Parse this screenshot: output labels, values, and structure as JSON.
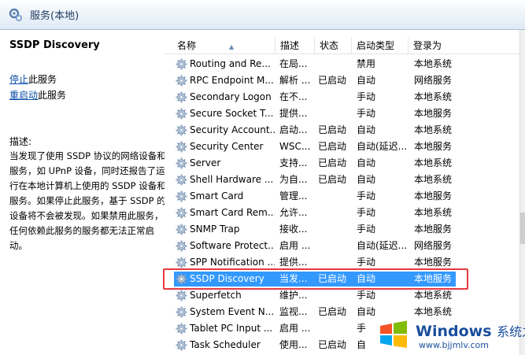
{
  "header": {
    "title": "服务(本地)"
  },
  "left_panel": {
    "service_name": "SSDP Discovery",
    "stop_link": "停止",
    "stop_suffix": "此服务",
    "restart_link": "重启动",
    "restart_suffix": "此服务",
    "description_label": "描述:",
    "description": "当发现了使用 SSDP 协议的网络设备和服务，如 UPnP 设备，同时还报告了运行在本地计算机上使用的 SSDP 设备和服务。如果停止此服务，基于 SSDP 的设备将不会被发现。如果禁用此服务，任何依赖此服务的服务都无法正常启动。"
  },
  "columns": {
    "name": "名称",
    "description": "描述",
    "status": "状态",
    "startup": "启动类型",
    "logon": "登录为"
  },
  "services": [
    {
      "name": "Routing and Re...",
      "description": "在局...",
      "status": "",
      "startup": "禁用",
      "logon": "本地系统"
    },
    {
      "name": "RPC Endpoint M...",
      "description": "解析 ...",
      "status": "已启动",
      "startup": "自动",
      "logon": "网络服务"
    },
    {
      "name": "Secondary Logon",
      "description": "在不...",
      "status": "",
      "startup": "手动",
      "logon": "本地系统"
    },
    {
      "name": "Secure Socket T...",
      "description": "提供...",
      "status": "",
      "startup": "手动",
      "logon": "本地服务"
    },
    {
      "name": "Security Account...",
      "description": "启动...",
      "status": "已启动",
      "startup": "自动",
      "logon": "本地系统"
    },
    {
      "name": "Security Center",
      "description": "WSC...",
      "status": "已启动",
      "startup": "自动(延迟...",
      "logon": "本地服务"
    },
    {
      "name": "Server",
      "description": "支持...",
      "status": "已启动",
      "startup": "自动",
      "logon": "本地系统"
    },
    {
      "name": "Shell Hardware ...",
      "description": "为自...",
      "status": "已启动",
      "startup": "自动",
      "logon": "本地系统"
    },
    {
      "name": "Smart Card",
      "description": "管理...",
      "status": "",
      "startup": "手动",
      "logon": "本地服务"
    },
    {
      "name": "Smart Card Rem...",
      "description": "允许...",
      "status": "",
      "startup": "手动",
      "logon": "本地系统"
    },
    {
      "name": "SNMP Trap",
      "description": "接收...",
      "status": "",
      "startup": "手动",
      "logon": "本地服务"
    },
    {
      "name": "Software Protect...",
      "description": "启用 ...",
      "status": "",
      "startup": "自动(延迟...",
      "logon": "网络服务"
    },
    {
      "name": "SPP Notification ...",
      "description": "提供...",
      "status": "",
      "startup": "手动",
      "logon": "本地服务"
    },
    {
      "name": "SSDP Discovery",
      "description": "当发...",
      "status": "已启动",
      "startup": "自动",
      "logon": "本地服务",
      "selected": true
    },
    {
      "name": "Superfetch",
      "description": "维护...",
      "status": "",
      "startup": "手动",
      "logon": "本地系统"
    },
    {
      "name": "System Event N...",
      "description": "监视...",
      "status": "已启动",
      "startup": "自动",
      "logon": "本地系统"
    },
    {
      "name": "Tablet PC Input ...",
      "description": "启用 ...",
      "status": "",
      "startup": "手",
      "logon": ""
    },
    {
      "name": "Task Scheduler",
      "description": "使用...",
      "status": "已启动",
      "startup": "自",
      "logon": ""
    }
  ],
  "watermark": {
    "brand": "Windows",
    "brand_cn": "系统之家",
    "url": "www.bjjmlv.com"
  },
  "colors": {
    "selection": "#3399ff",
    "highlight_box": "#e8383d",
    "link": "#0a4fa8"
  },
  "icons": {
    "header": "services-icon",
    "row": "gear-icon"
  }
}
